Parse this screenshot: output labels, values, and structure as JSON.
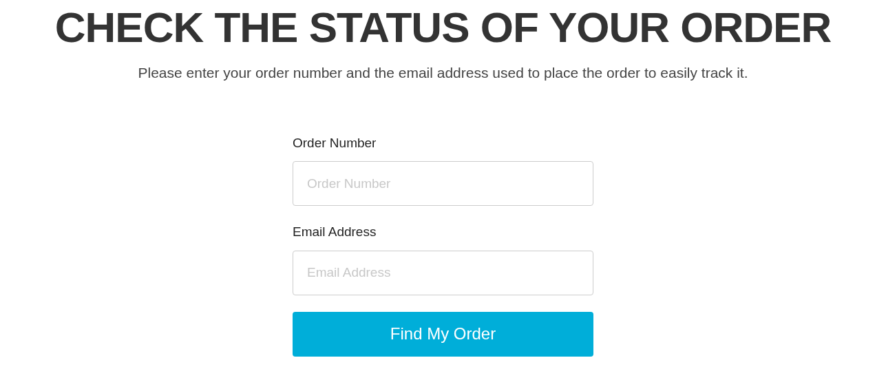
{
  "heading": "CHECK THE STATUS OF YOUR ORDER",
  "intro": "Please enter your order number and the email address used to place the order to easily track it.",
  "fields": [
    {
      "label": "Order Number",
      "placeholder": "Order Number"
    },
    {
      "label": "Email Address",
      "placeholder": "Email Address"
    }
  ],
  "button": "Find My Order"
}
